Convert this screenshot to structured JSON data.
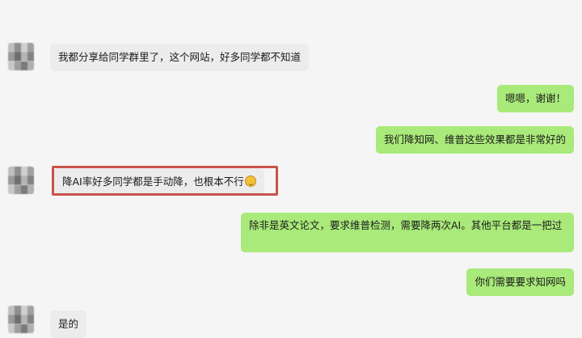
{
  "colors": {
    "background": "#f5f5f5",
    "incoming_bubble": "#ececec",
    "outgoing_bubble": "#a9ea7a",
    "highlight_border": "#c9534c"
  },
  "messages": [
    {
      "side": "left",
      "text": "我都分享给同学群里了，这个网站，好多同学都不知道"
    },
    {
      "side": "right",
      "text": "嗯嗯，谢谢！"
    },
    {
      "side": "right",
      "text": "我们降知网、维普这些效果都是非常好的"
    },
    {
      "side": "left",
      "text": "降AI率好多同学都是手动降，也根本不行",
      "emoji": "emoji-icon",
      "highlighted": true
    },
    {
      "side": "right",
      "text": "除非是英文论文，要求维普检测，需要降两次AI。其他平台都是一把过"
    },
    {
      "side": "right",
      "text": "你们需要要求知网吗"
    },
    {
      "side": "left",
      "text": "是的"
    }
  ]
}
